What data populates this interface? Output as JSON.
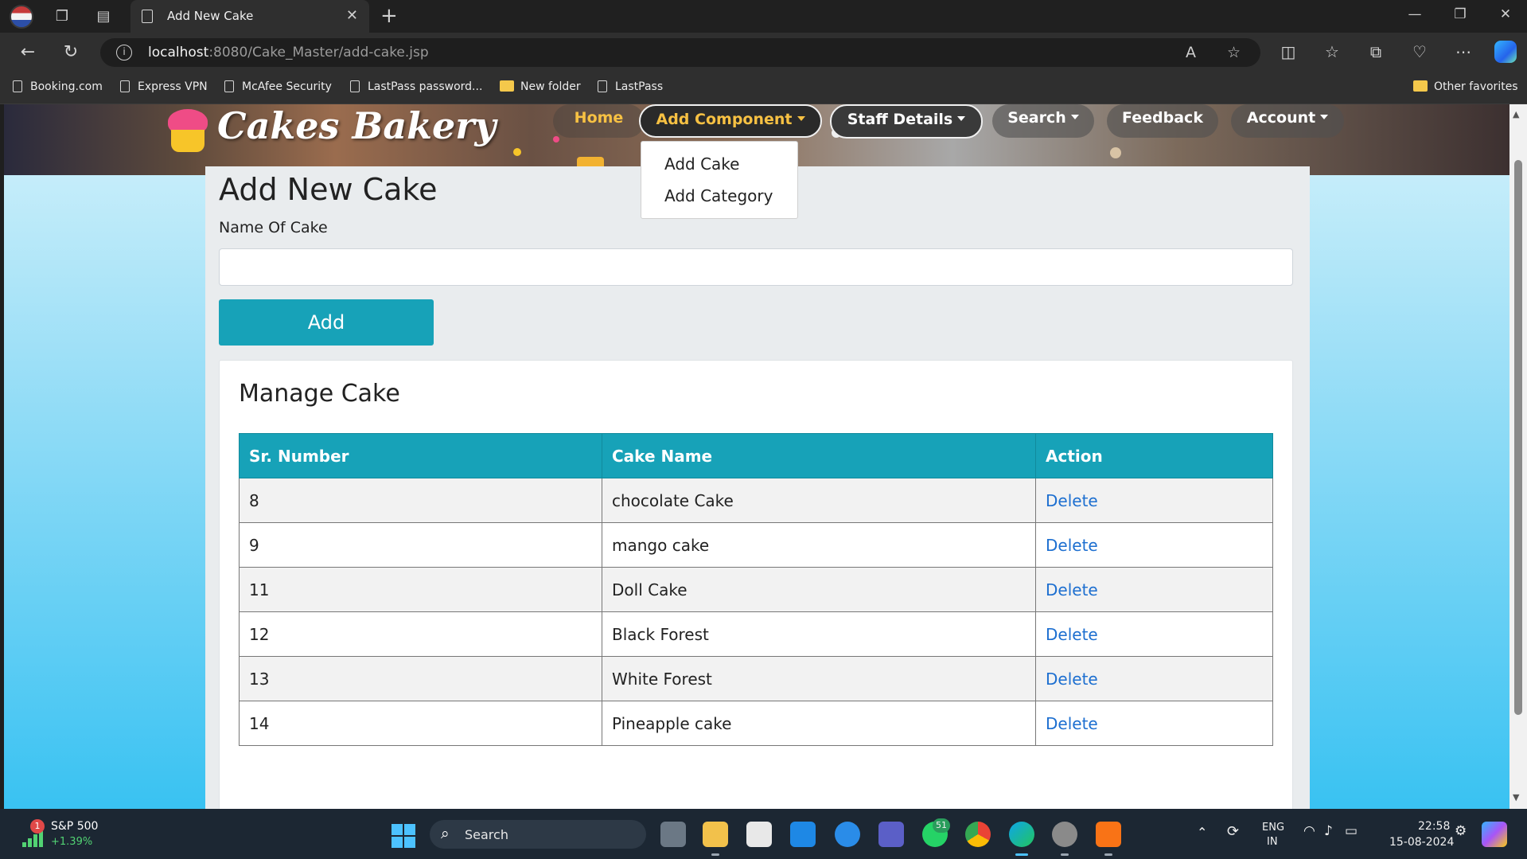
{
  "browser": {
    "tab_title": "Add New Cake",
    "url_host": "localhost",
    "url_path": ":8080/Cake_Master/add-cake.jsp",
    "bookmarks": [
      "Booking.com",
      "Express VPN",
      "McAfee Security",
      "LastPass password...",
      "New folder",
      "LastPass"
    ],
    "other_favorites": "Other favorites"
  },
  "site": {
    "logo": "Cakes Bakery",
    "nav": {
      "home": "Home",
      "add_component": "Add Component",
      "staff_details": "Staff Details",
      "search": "Search",
      "feedback": "Feedback",
      "account": "Account"
    },
    "dropdown": [
      "Add Cake",
      "Add Category"
    ]
  },
  "form": {
    "title": "Add New Cake",
    "name_label": "Name Of Cake",
    "name_value": "",
    "add_button": "Add"
  },
  "manage": {
    "title": "Manage Cake",
    "columns": [
      "Sr. Number",
      "Cake Name",
      "Action"
    ],
    "rows": [
      {
        "sr": "8",
        "name": "chocolate Cake",
        "action": "Delete"
      },
      {
        "sr": "9",
        "name": "mango cake",
        "action": "Delete"
      },
      {
        "sr": "11",
        "name": "Doll Cake",
        "action": "Delete"
      },
      {
        "sr": "12",
        "name": "Black Forest",
        "action": "Delete"
      },
      {
        "sr": "13",
        "name": "White Forest",
        "action": "Delete"
      },
      {
        "sr": "14",
        "name": "Pineapple cake",
        "action": "Delete"
      }
    ]
  },
  "taskbar": {
    "stock_name": "S&P 500",
    "stock_change": "+1.39%",
    "stock_badge": "1",
    "search_label": "Search",
    "whatsapp_badge": "51",
    "lang_top": "ENG",
    "lang_bottom": "IN",
    "time": "22:58",
    "date": "15-08-2024"
  },
  "colors": {
    "accent_teal": "#17a2b8",
    "link_blue": "#1d6fd0",
    "nav_gold": "#f7c143"
  }
}
